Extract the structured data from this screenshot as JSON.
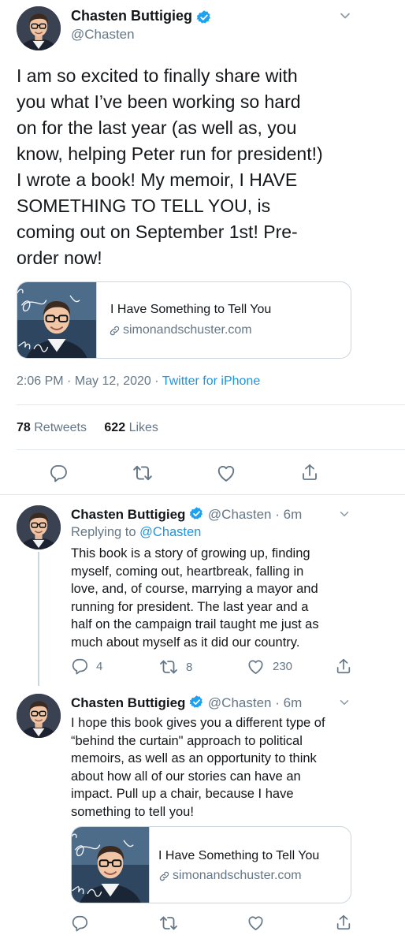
{
  "main_tweet": {
    "author_name": "Chasten Buttigieg",
    "handle": "@Chasten",
    "text_lines": [
      "I am so excited to finally share with",
      "you what I’ve been working so hard",
      "on for the last year (as well as, you",
      "know, helping Peter run for president!)",
      "I wrote a book! My memoir, I HAVE",
      "SOMETHING TO TELL YOU, is",
      "coming out on September 1st! Pre-",
      "order now!"
    ],
    "card": {
      "title": "I Have Something to Tell You",
      "domain": "simonandschuster.com"
    },
    "time": "2:06 PM",
    "separator": "·",
    "date": "May 12, 2020",
    "source": "Twitter for iPhone",
    "retweets_count": "78",
    "retweets_label": "Retweets",
    "likes_count": "622",
    "likes_label": "Likes"
  },
  "reply1": {
    "author_name": "Chasten Buttigieg",
    "handle": "@Chasten",
    "time": "· 6m",
    "replying_prefix": "Replying to",
    "replying_handle": "@Chasten",
    "text_lines": [
      "This book is a story of growing up, finding",
      "myself, coming out, heartbreak, falling in",
      "love, and, of course, marrying a mayor and",
      "running for president. The last year and a",
      "half on the campaign trail taught me just as",
      "much about myself as it did our country."
    ],
    "replies": "4",
    "retweets": "8",
    "likes": "230"
  },
  "reply2": {
    "author_name": "Chasten Buttigieg",
    "handle": "@Chasten",
    "time": "· 6m",
    "text_lines": [
      "I hope this book gives you a different type of",
      "“behind the curtain\" approach to political",
      "memoirs, as well as an opportunity to think",
      "about how all of our stories can have an",
      "impact. Pull up a chair, because I have",
      "something to tell you!"
    ],
    "card": {
      "title": "I Have Something to Tell You",
      "domain": "simonandschuster.com"
    }
  },
  "colors": {
    "text": "#14171a",
    "secondary": "#657786",
    "link": "#1b95e0",
    "border": "#ccd6dd",
    "verified": "#1da1f2"
  },
  "icons": [
    "verified-badge-icon",
    "chevron-down-icon",
    "link-icon",
    "reply-icon",
    "retweet-icon",
    "like-icon",
    "share-icon"
  ]
}
